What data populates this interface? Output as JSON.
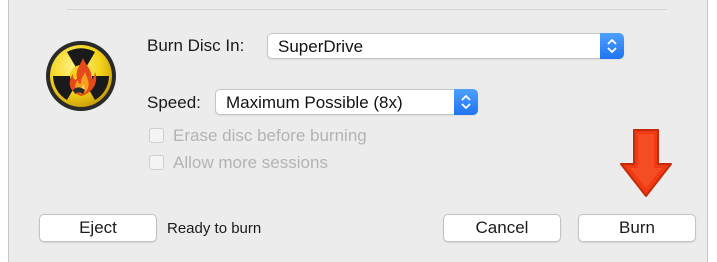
{
  "burn_disc_in": {
    "label": "Burn Disc In:",
    "value": "SuperDrive"
  },
  "speed": {
    "label": "Speed:",
    "value": "Maximum Possible (8x)"
  },
  "options": [
    {
      "label": "Erase disc before burning",
      "checked": false,
      "enabled": false
    },
    {
      "label": "Allow more sessions",
      "checked": false,
      "enabled": false
    }
  ],
  "buttons": {
    "eject": "Eject",
    "cancel": "Cancel",
    "burn": "Burn"
  },
  "status": "Ready to burn",
  "icons": {
    "app": "burn-radiation-flame-icon",
    "stepper": "chevron-updown-icon",
    "annotation": "arrow-down-icon"
  },
  "colors": {
    "accent": "#2a82f8",
    "annotation_arrow": "#f03a14"
  }
}
